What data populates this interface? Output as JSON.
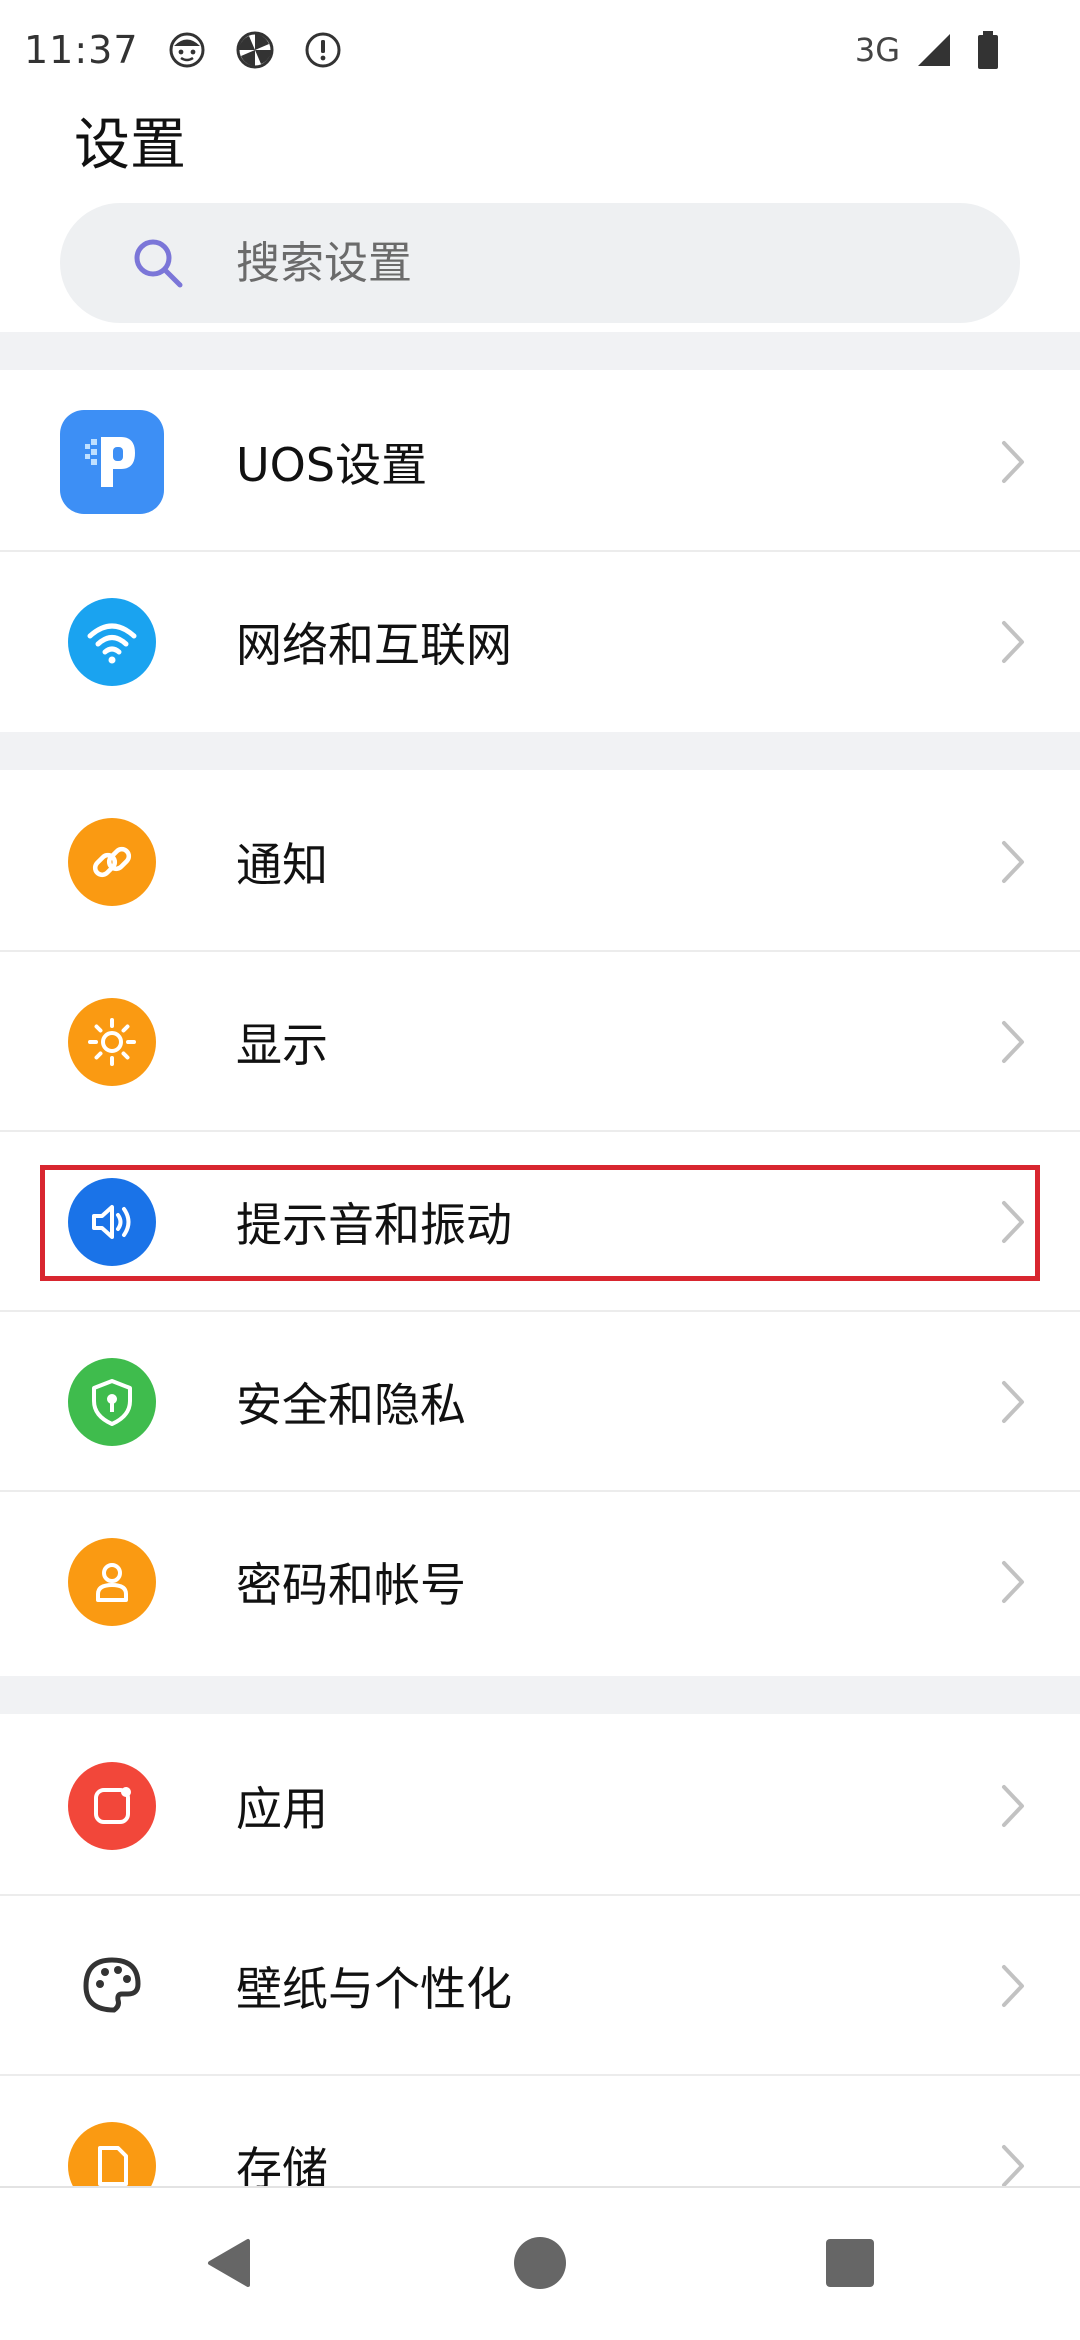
{
  "status_bar": {
    "time": "11:37",
    "left_icons": [
      "face-icon",
      "pinwheel-icon",
      "alert-icon"
    ],
    "network": "3G",
    "right_icons": [
      "signal-icon",
      "battery-icon"
    ]
  },
  "page": {
    "title": "设置"
  },
  "search": {
    "placeholder": "搜索设置"
  },
  "colors": {
    "uos": "#3d8ff5",
    "network": "#1aa3f0",
    "notify": "#fa9a12",
    "display": "#fa9a12",
    "sound": "#1a73e8",
    "security": "#3fbc4d",
    "account": "#fa9a12",
    "apps": "#f2473a",
    "storage": "#fa9a12",
    "highlight": "#d8262f",
    "chevron": "#c2c2c2"
  },
  "groups": [
    {
      "items": [
        {
          "label": "UOS设置",
          "icon": "uos-app-icon"
        },
        {
          "label": "网络和互联网",
          "icon": "wifi-icon"
        }
      ]
    },
    {
      "items": [
        {
          "label": "通知",
          "icon": "link-icon"
        },
        {
          "label": "显示",
          "icon": "sun-icon"
        },
        {
          "label": "提示音和振动",
          "icon": "speaker-icon"
        },
        {
          "label": "安全和隐私",
          "icon": "shield-icon"
        },
        {
          "label": "密码和帐号",
          "icon": "person-icon"
        }
      ]
    },
    {
      "items": [
        {
          "label": "应用",
          "icon": "apps-icon"
        },
        {
          "label": "壁纸与个性化",
          "icon": "palette-icon"
        },
        {
          "label": "存储",
          "icon": "storage-icon"
        }
      ]
    }
  ],
  "navigation": {
    "buttons": [
      "back-icon",
      "home-icon",
      "recents-icon"
    ]
  }
}
